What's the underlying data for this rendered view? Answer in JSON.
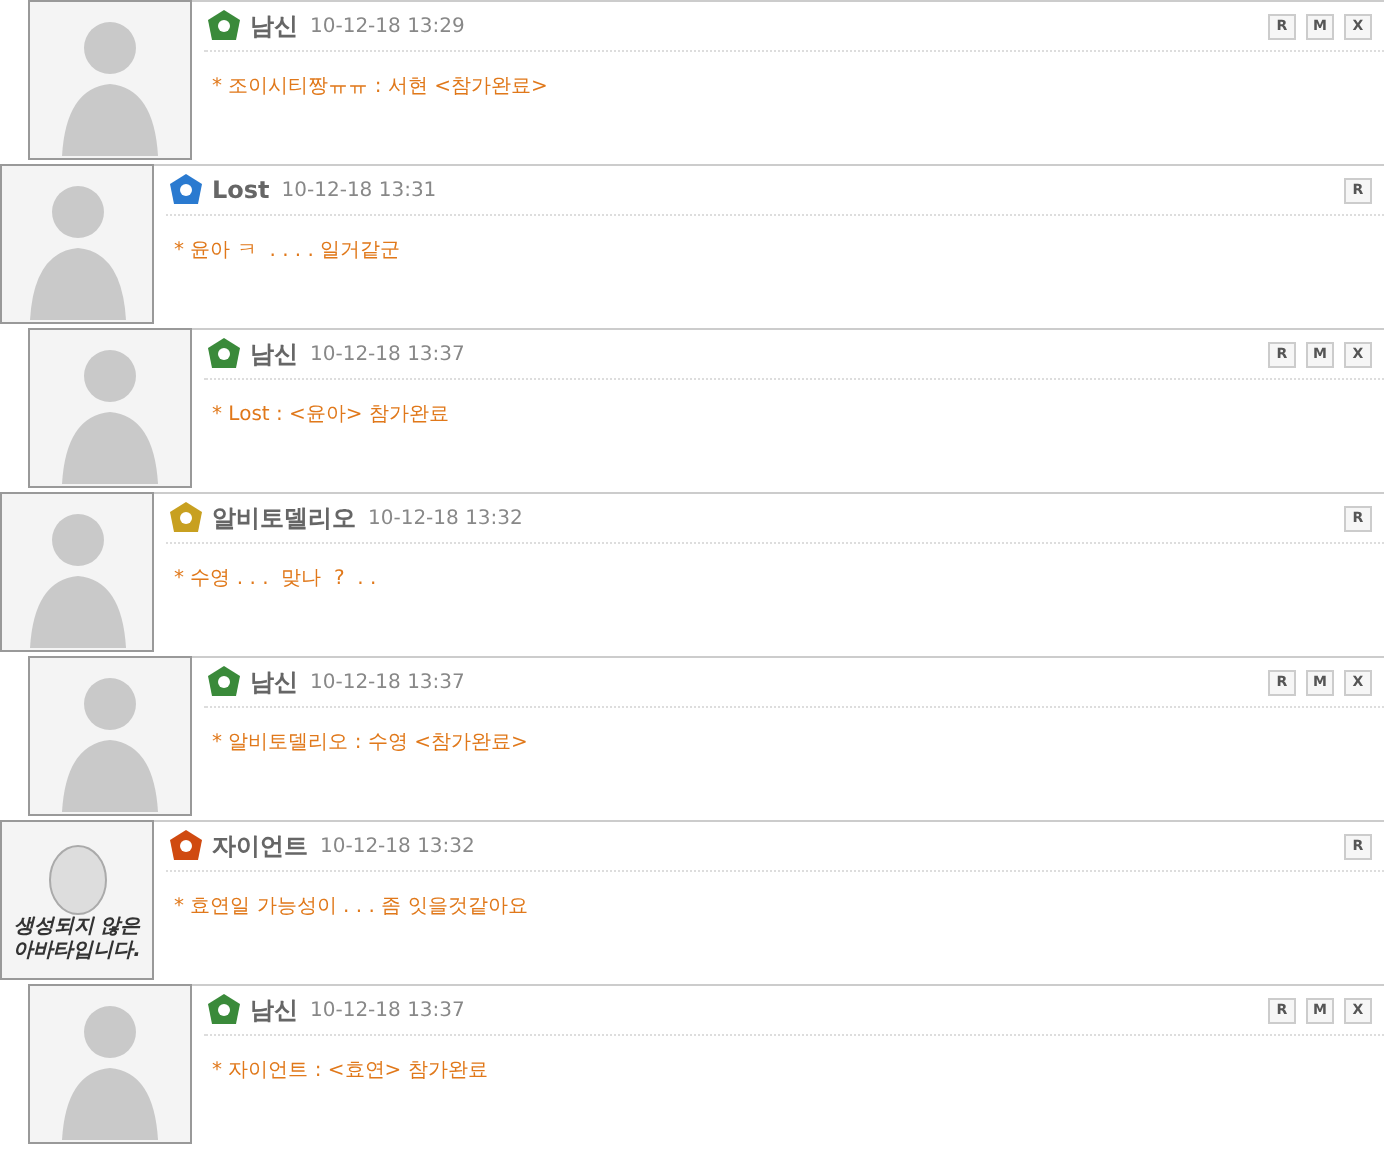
{
  "comments": [
    {
      "kind": "reply",
      "avatar": {
        "kind": "character"
      },
      "color": "#3a8a3a",
      "name": "남신",
      "date": "10-12-18 13:29",
      "message": "* 조이시티짱ㅠㅠ : 서현 <참가완료>",
      "buttons": [
        "R",
        "M",
        "X"
      ]
    },
    {
      "kind": "comment",
      "avatar": {
        "kind": "character"
      },
      "color": "#2a7ad0",
      "name": "Lost",
      "date": "10-12-18 13:31",
      "message": "* 윤아 ㅋ  . . . . 일거같군",
      "buttons": [
        "R"
      ]
    },
    {
      "kind": "reply",
      "avatar": {
        "kind": "character"
      },
      "color": "#3a8a3a",
      "name": "남신",
      "date": "10-12-18 13:37",
      "message": "* Lost : <윤아> 참가완료",
      "buttons": [
        "R",
        "M",
        "X"
      ]
    },
    {
      "kind": "comment",
      "avatar": {
        "kind": "character"
      },
      "color": "#c8a020",
      "name": "알비토델리오",
      "date": "10-12-18 13:32",
      "message": "* 수영 . . .  맞나  ?  . .",
      "buttons": [
        "R"
      ]
    },
    {
      "kind": "reply",
      "avatar": {
        "kind": "character"
      },
      "color": "#3a8a3a",
      "name": "남신",
      "date": "10-12-18 13:37",
      "message": "* 알비토델리오 : 수영 <참가완료>",
      "buttons": [
        "R",
        "M",
        "X"
      ]
    },
    {
      "kind": "comment",
      "avatar": {
        "kind": "egg",
        "caption": "생성되지 않은 아바타입니다."
      },
      "color": "#d04a10",
      "name": "자이언트",
      "date": "10-12-18 13:32",
      "message": "* 효연일 가능성이 . . . 좀 잇을것같아요",
      "buttons": [
        "R"
      ]
    },
    {
      "kind": "reply",
      "avatar": {
        "kind": "character"
      },
      "color": "#3a8a3a",
      "name": "남신",
      "date": "10-12-18 13:37",
      "message": "* 자이언트 : <효연> 참가완료",
      "buttons": [
        "R",
        "M",
        "X"
      ]
    }
  ]
}
